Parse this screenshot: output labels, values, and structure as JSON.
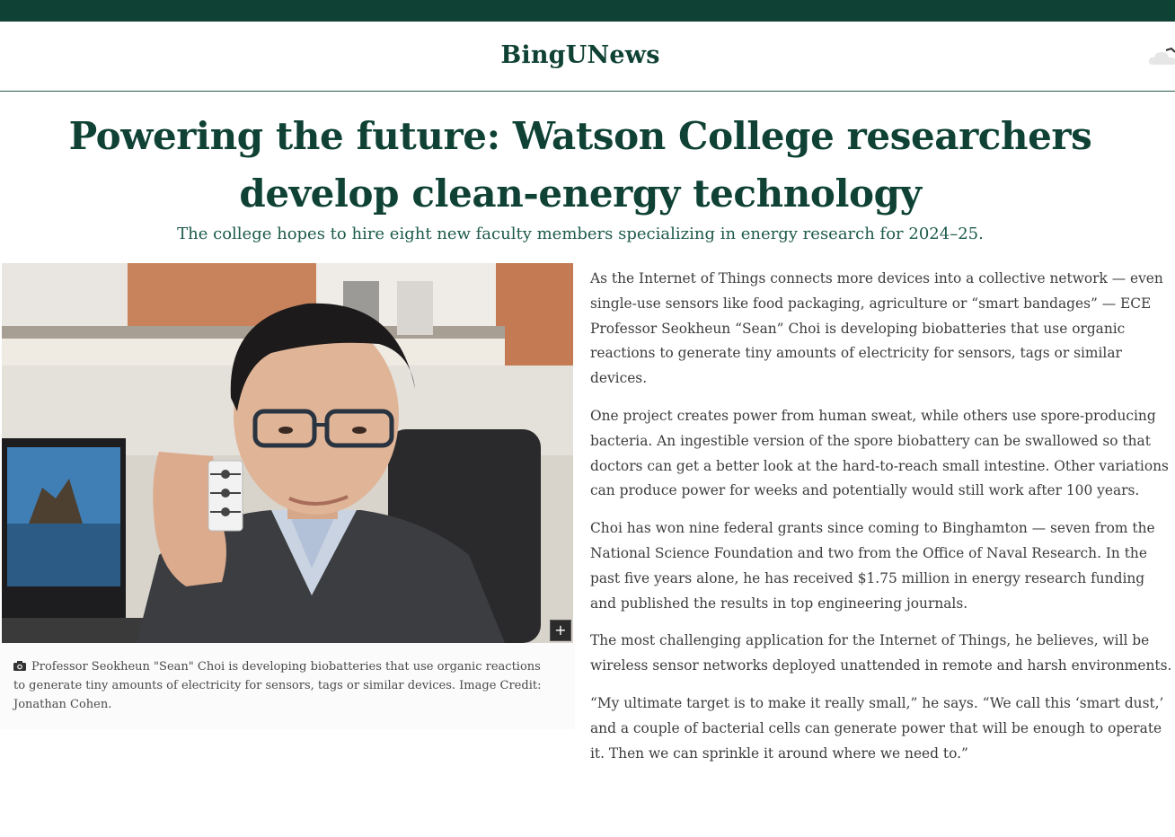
{
  "site": {
    "name": "BingUNews"
  },
  "article": {
    "headline": "Powering the future: Watson College researchers develop clean-energy technology",
    "subtitle": "The college hopes to hire eight new faculty members specializing in energy research for 2024–25.",
    "paragraphs": [
      "As the Internet of Things connects more devices into a collective network — even single-use sensors like food packaging, agriculture or “smart bandages” — ECE Professor Seokheun “Sean” Choi is developing biobatteries that use organic reactions to generate tiny amounts of electricity for sensors, tags or similar devices.",
      "One project creates power from human sweat, while others use spore-producing bacteria. An ingestible version of the spore biobattery can be swallowed so that doctors can get a better look at the hard-to-reach small intestine. Other variations can produce power for weeks and potentially would still work after 100 years.",
      "Choi has won nine federal grants since coming to Binghamton — seven from the National Science Foundation and two from the Office of Naval Research. In the past five years alone, he has received $1.75 million in energy research funding and published the results in top engineering journals.",
      "The most challenging application for the Internet of Things, he believes, will be wireless sensor networks deployed unattended in remote and harsh environments.",
      "“My ultimate target is to make it really small,” he says. “We call this ‘smart dust,’ and a couple of bacterial cells can generate power that will be enough to operate it. Then we can sprinkle it around where we need to.”"
    ]
  },
  "photo": {
    "expand_label": "+",
    "caption": "Professor Seokheun \"Sean\" Choi is developing biobatteries that use organic reactions to generate tiny amounts of electricity for sensors, tags or similar devices. Image Credit: Jonathan Cohen.",
    "caption_icon": "camera-icon"
  },
  "colors": {
    "brand_green": "#0f4234",
    "subtitle_green": "#1c5a4a",
    "body_text": "#3d3d3d"
  }
}
